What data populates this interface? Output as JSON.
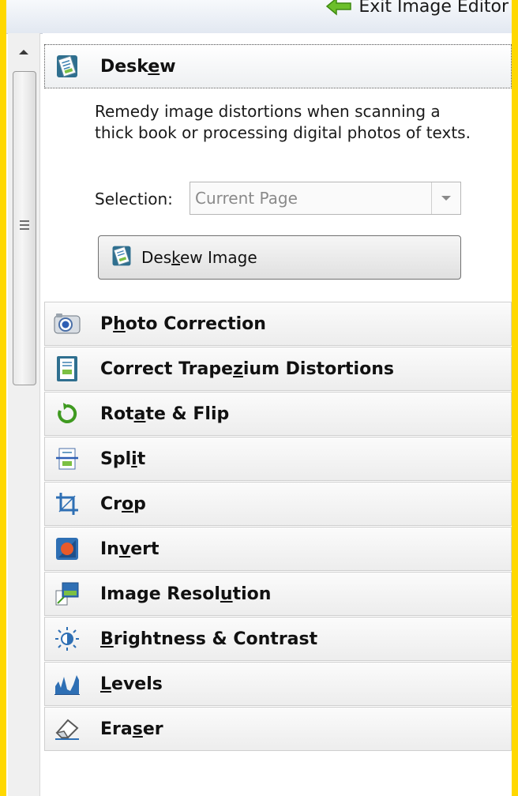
{
  "topbar": {
    "exit_label": "Exit Image Editor"
  },
  "deskew": {
    "title_pre": "Desk",
    "title_u": "e",
    "title_post": "w",
    "description": "Remedy image distortions when scanning a thick book or processing digital photos of texts.",
    "selection_label": "Selection:",
    "selection_value": "Current Page",
    "button_pre": "Des",
    "button_u": "k",
    "button_post": "ew Image"
  },
  "tools": [
    {
      "pre": "P",
      "u": "h",
      "post": "oto Correction",
      "icon": "camera-icon"
    },
    {
      "pre": "Correct Trape",
      "u": "z",
      "post": "ium Distortions",
      "icon": "trapezium-icon"
    },
    {
      "pre": "Rot",
      "u": "a",
      "post": "te & Flip",
      "icon": "rotate-icon"
    },
    {
      "pre": "Spl",
      "u": "i",
      "post": "t",
      "icon": "split-icon"
    },
    {
      "pre": "Cr",
      "u": "o",
      "post": "p",
      "icon": "crop-icon"
    },
    {
      "pre": "In",
      "u": "v",
      "post": "ert",
      "icon": "invert-icon"
    },
    {
      "pre": "Image Resol",
      "u": "u",
      "post": "tion",
      "icon": "image-resolution-icon"
    },
    {
      "pre": "",
      "u": "B",
      "post": "rightness & Contrast",
      "icon": "brightness-icon"
    },
    {
      "pre": "",
      "u": "L",
      "post": "evels",
      "icon": "levels-icon"
    },
    {
      "pre": "Era",
      "u": "s",
      "post": "er",
      "icon": "eraser-icon"
    }
  ]
}
